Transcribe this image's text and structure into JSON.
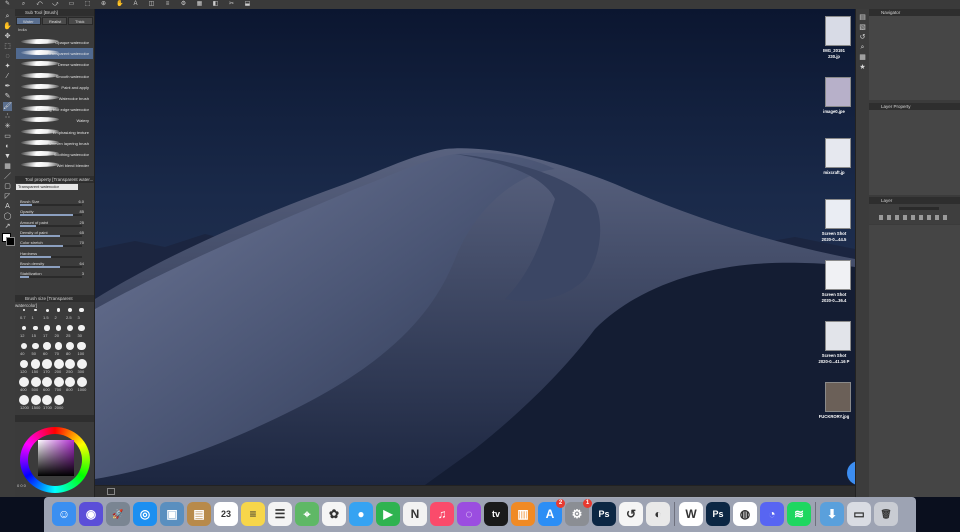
{
  "top_strip": {
    "icons": [
      "pen-icon",
      "brush-icon",
      "eraser-icon",
      "fill-icon",
      "select-icon",
      "zoom-icon",
      "hand-icon",
      "text-icon",
      "ruler-icon",
      "gear-icon",
      "layer-icon",
      "undo-icon",
      "redo-icon",
      "save-icon",
      "filter-icon",
      "grid-icon"
    ]
  },
  "subtool_panel": {
    "title": "Sub Tool [Brush]",
    "tabs": [
      "Water",
      "Realist",
      "Thick"
    ],
    "group": "India",
    "brushes": [
      {
        "name": "Opaque watercolor",
        "selected": false
      },
      {
        "name": "Transparent watercolor",
        "selected": true
      },
      {
        "name": "Dense watercolor",
        "selected": false
      },
      {
        "name": "Smooth watercolor",
        "selected": false
      },
      {
        "name": "Paint and apply",
        "selected": false
      },
      {
        "name": "Watercolor brush",
        "selected": false
      },
      {
        "name": "Running blur edge watercolor",
        "selected": false
      },
      {
        "name": "Watery",
        "selected": false
      },
      {
        "name": "Emphasizing texture",
        "selected": false
      },
      {
        "name": "Uneven layering brush",
        "selected": false
      },
      {
        "name": "Soothing watercolor",
        "selected": false
      },
      {
        "name": "Wet blend blender",
        "selected": false
      }
    ]
  },
  "tool_property": {
    "title": "Tool property [Transparent water...",
    "preset": "Transparent watercolor",
    "props": [
      {
        "label": "Brush Size",
        "value": "6.0",
        "fill": 0.2
      },
      {
        "label": "Opacity",
        "value": "85",
        "fill": 0.85
      },
      {
        "label": "Amount of paint",
        "value": "25",
        "fill": 0.25
      },
      {
        "label": "Density of paint",
        "value": "65",
        "fill": 0.65
      },
      {
        "label": "Color stretch",
        "value": "70",
        "fill": 0.7
      },
      {
        "label": "Hardness",
        "value": "",
        "fill": 0.5
      },
      {
        "label": "Brush density",
        "value": "64",
        "fill": 0.64
      },
      {
        "label": "Stabilization",
        "value": "3",
        "fill": 0.15
      }
    ]
  },
  "brush_size": {
    "title": "Brush size [Transparent watercolor]",
    "row1": [
      "0.7",
      "1",
      "1.5",
      "2",
      "2.5",
      "3"
    ],
    "row2": [
      "12",
      "15",
      "17",
      "20",
      "25",
      "30"
    ],
    "row3": [
      "40",
      "50",
      "60",
      "70",
      "80",
      "100"
    ],
    "row4": [
      "120",
      "150",
      "170",
      "200",
      "250",
      "300"
    ],
    "row5": [
      "400",
      "500",
      "600",
      "700",
      "800",
      "1000"
    ],
    "row6": [
      "1200",
      "1500",
      "1700",
      "2000"
    ]
  },
  "color": {
    "swatch_main": "#ffffff",
    "swatch_sub": "#000000",
    "footer": "0 0 0"
  },
  "desktop_icons": [
    {
      "label1": "IMG_20191",
      "label2": "230.jp",
      "thumb": "#d8dbe6"
    },
    {
      "label1": "image0.jpe",
      "label2": "",
      "thumb": "#b7b0c9"
    },
    {
      "label1": "mixcraft.jp",
      "label2": "",
      "thumb": "#e6e8ef"
    },
    {
      "label1": "Screen Shot",
      "label2": "2020-0...44.5",
      "thumb": "#eaedf3"
    },
    {
      "label1": "Screen Shot",
      "label2": "2020-0...36.4",
      "thumb": "#f0f1f4"
    },
    {
      "label1": "Screen Shot",
      "label2": "2020-0...41.16 P",
      "thumb": "#e2e4ea"
    },
    {
      "label1": "FUCKRORY.jpg",
      "label2": "",
      "thumb": "#6b6058"
    }
  ],
  "right_panels": {
    "navigator": "Navigator",
    "layer_property": "Layer Property",
    "layer": "Layer"
  },
  "dock": {
    "apps": [
      {
        "name": "finder-icon",
        "glyph": "☺",
        "color": "#3b8ff0"
      },
      {
        "name": "siri-icon",
        "glyph": "◉",
        "color": "#5b4fd8"
      },
      {
        "name": "launchpad-icon",
        "glyph": "🚀",
        "color": "#7a8592"
      },
      {
        "name": "safari-icon",
        "glyph": "◎",
        "color": "#1c8ff0"
      },
      {
        "name": "preview-icon",
        "glyph": "▣",
        "color": "#5a8fbf"
      },
      {
        "name": "notefile-icon",
        "glyph": "▤",
        "color": "#b88a4a"
      },
      {
        "name": "calendar-icon",
        "glyph": "23",
        "color": "#ffffff"
      },
      {
        "name": "notes-icon",
        "glyph": "≡",
        "color": "#f7d64a"
      },
      {
        "name": "reminders-icon",
        "glyph": "☰",
        "color": "#f4f4f4"
      },
      {
        "name": "maps-icon",
        "glyph": "⌖",
        "color": "#5fb866"
      },
      {
        "name": "photos-icon",
        "glyph": "✿",
        "color": "#f5f5f5"
      },
      {
        "name": "messages-icon",
        "glyph": "●",
        "color": "#36a3f2"
      },
      {
        "name": "facetime-icon",
        "glyph": "▶",
        "color": "#2fb350"
      },
      {
        "name": "news-icon",
        "glyph": "N",
        "color": "#f2f2f2"
      },
      {
        "name": "music-icon",
        "glyph": "♫",
        "color": "#fa4b6b"
      },
      {
        "name": "podcasts-icon",
        "glyph": "◌",
        "color": "#9b4de0"
      },
      {
        "name": "tv-icon",
        "glyph": "tv",
        "color": "#1a1a1a"
      },
      {
        "name": "books-icon",
        "glyph": "▥",
        "color": "#f08a24"
      },
      {
        "name": "appstore-icon",
        "glyph": "A",
        "color": "#2c8ef5",
        "badge": "2"
      },
      {
        "name": "system-preferences-icon",
        "glyph": "⚙",
        "color": "#8b8e94",
        "badge": "1"
      },
      {
        "name": "photoshop-icon",
        "glyph": "Ps",
        "color": "#0c2744"
      },
      {
        "name": "clip-studio-icon",
        "glyph": "↺",
        "color": "#f5f5f5"
      },
      {
        "name": "clip-studio-paint-icon",
        "glyph": "◐",
        "color": "#e9e9e9"
      },
      {
        "name": "webex-icon",
        "glyph": "W",
        "color": "#ffffff"
      },
      {
        "name": "photoshop-2-icon",
        "glyph": "Ps",
        "color": "#0c2744"
      },
      {
        "name": "chrome-icon",
        "glyph": "◍",
        "color": "#ffffff"
      },
      {
        "name": "discord-icon",
        "glyph": "◔",
        "color": "#5865f2"
      },
      {
        "name": "spotify-icon",
        "glyph": "≋",
        "color": "#1ed760"
      },
      {
        "name": "downloads-folder-icon",
        "glyph": "⬇",
        "color": "#5aa0dc"
      },
      {
        "name": "screenshot-stack-icon",
        "glyph": "▭",
        "color": "#d9dce3"
      },
      {
        "name": "trash-icon",
        "glyph": "🗑",
        "color": "#c9ccd3"
      }
    ]
  }
}
